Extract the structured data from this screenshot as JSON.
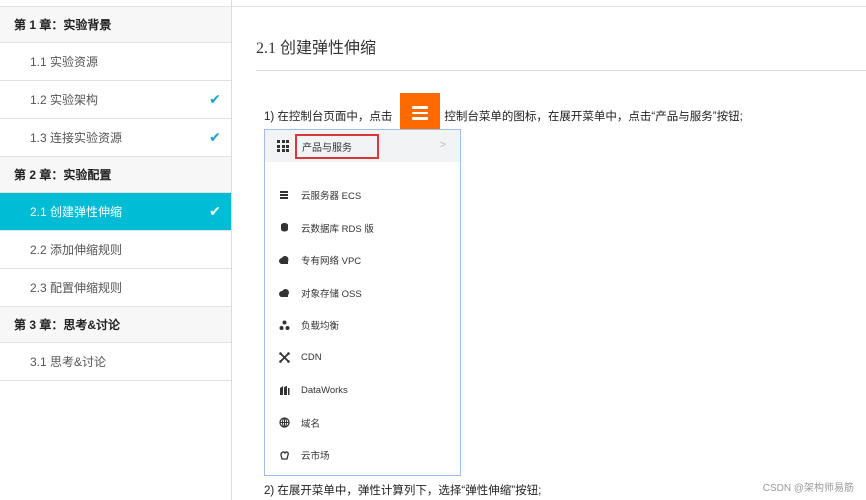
{
  "sidebar": {
    "chapters": [
      {
        "title": "第 1 章：实验背景",
        "items": [
          {
            "label": "1.1 实验资源",
            "done": false
          },
          {
            "label": "1.2 实验架构",
            "done": true
          },
          {
            "label": "1.3 连接实验资源",
            "done": true
          }
        ]
      },
      {
        "title": "第 2 章：实验配置",
        "items": [
          {
            "label": "2.1 创建弹性伸缩",
            "done": true,
            "active": true
          },
          {
            "label": "2.2 添加伸缩规则",
            "done": false
          },
          {
            "label": "2.3 配置伸缩规则",
            "done": false
          }
        ]
      },
      {
        "title": "第 3 章：思考&讨论",
        "items": [
          {
            "label": "3.1 思考&讨论",
            "done": false
          }
        ]
      }
    ],
    "check_icon": "check-icon",
    "accent_color": "#00bcd4"
  },
  "main": {
    "title": "2.1 创建弹性伸缩",
    "step1_before": "1) 在控制台页面中，点击",
    "step1_after": "控制台菜单的图标，在展开菜单中，点击“产品与服务”按钮;",
    "menu_button_color": "#ff6a00",
    "step2": "2) 在展开菜单中，弹性计算列下，选择“弹性伸缩”按钮;"
  },
  "console_menu": {
    "header": "产品与服务",
    "items": [
      {
        "label": "云服务器 ECS",
        "icon": "server-icon"
      },
      {
        "label": "云数据库 RDS 版",
        "icon": "database-icon"
      },
      {
        "label": "专有网络 VPC",
        "icon": "cloud-network-icon"
      },
      {
        "label": "对象存储 OSS",
        "icon": "cloud-storage-icon"
      },
      {
        "label": "负载均衡",
        "icon": "load-balance-icon"
      },
      {
        "label": "CDN",
        "icon": "cdn-icon"
      },
      {
        "label": "DataWorks",
        "icon": "dataworks-icon"
      },
      {
        "label": "域名",
        "icon": "globe-icon"
      },
      {
        "label": "云市场",
        "icon": "market-icon"
      }
    ]
  },
  "watermark": "CSDN @架构师易筋"
}
